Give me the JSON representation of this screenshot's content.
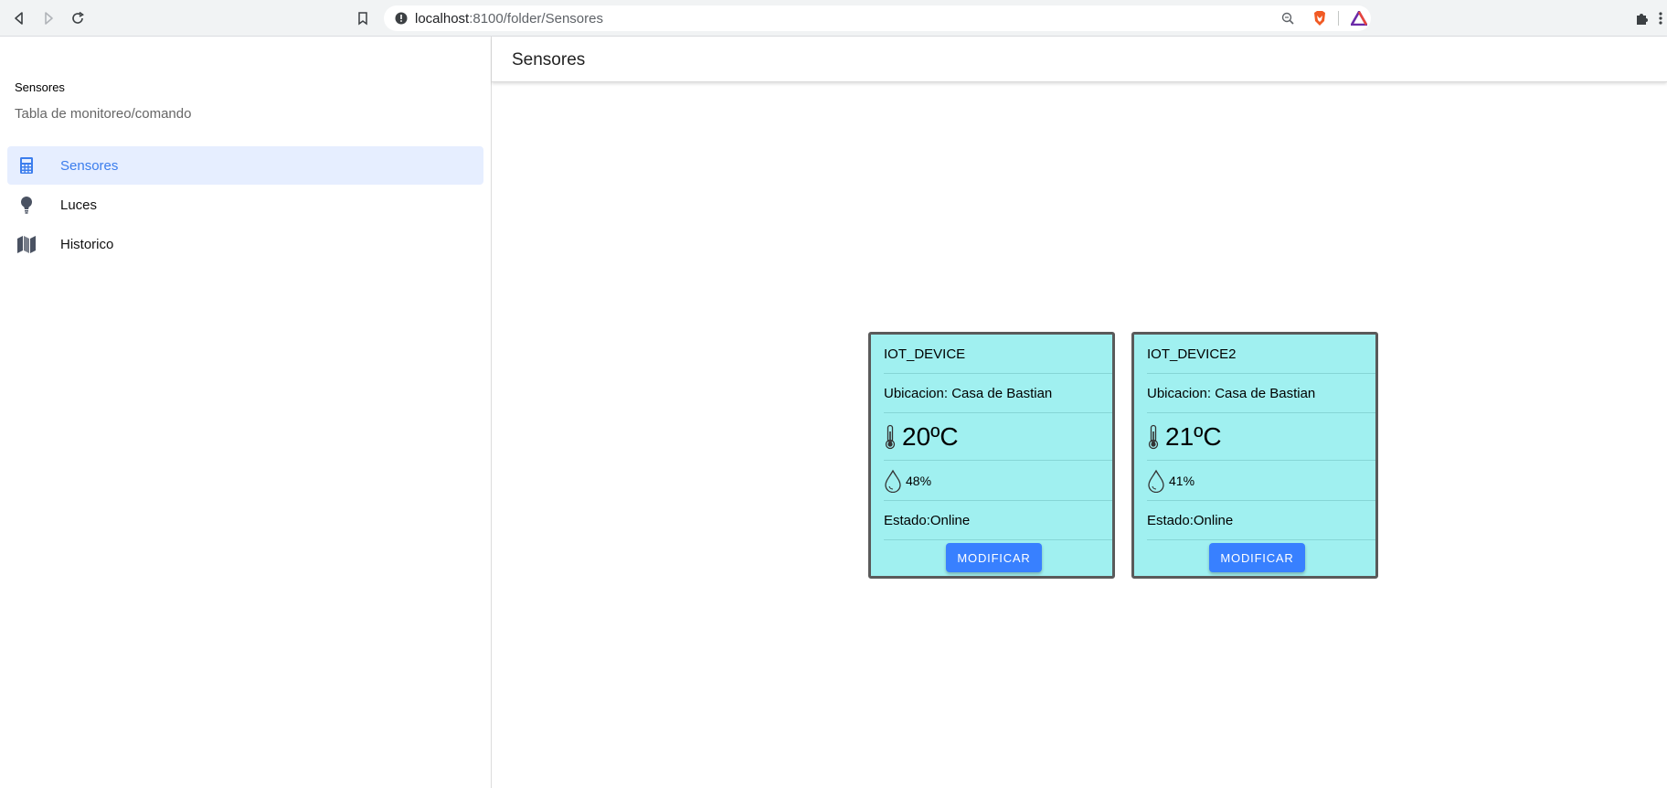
{
  "browser": {
    "url_host": "localhost",
    "url_path": ":8100/folder/Sensores"
  },
  "sidebar": {
    "title": "Sensores",
    "subtitle": "Tabla de monitoreo/comando",
    "items": [
      {
        "label": "Sensores",
        "icon": "calculator-icon",
        "active": true
      },
      {
        "label": "Luces",
        "icon": "bulb-icon",
        "active": false
      },
      {
        "label": "Historico",
        "icon": "map-icon",
        "active": false
      }
    ]
  },
  "header": {
    "title": "Sensores"
  },
  "devices": [
    {
      "name": "IOT_DEVICE",
      "location": "Ubicacion: Casa de Bastian",
      "temperature": "20ºC",
      "humidity": "48%",
      "status": "Estado:Online",
      "button": "MODIFICAR"
    },
    {
      "name": "IOT_DEVICE2",
      "location": "Ubicacion: Casa de Bastian",
      "temperature": "21ºC",
      "humidity": "41%",
      "status": "Estado:Online",
      "button": "MODIFICAR"
    }
  ],
  "colors": {
    "accent": "#3880ff",
    "card_bg": "#a0f0f0",
    "active_item_bg": "#e6eeff"
  }
}
